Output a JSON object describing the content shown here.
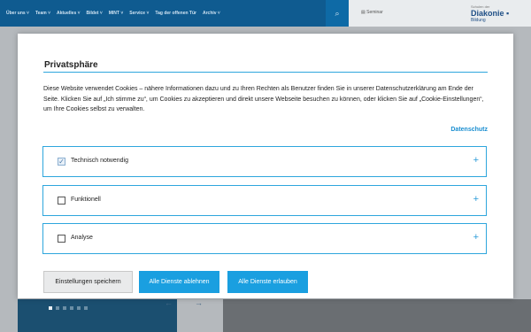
{
  "nav": {
    "items": [
      "Über uns",
      "Team",
      "Aktuelles",
      "Bildet",
      "MINT",
      "Service",
      "Tag der offenen Tür",
      "Archiv"
    ],
    "seminar_label": "Seminar"
  },
  "logo": {
    "top": "Schulen der",
    "main": "Diakonie",
    "sub": "Bildung"
  },
  "modal": {
    "title": "Privatsphäre",
    "description": "Diese Website verwendet Cookies – nähere Informationen dazu und zu Ihren Rechten als Benutzer finden Sie in unserer Datenschutzerklärung am Ende der Seite. Klicken Sie auf „Ich stimme zu“, um Cookies zu akzeptieren und direkt unsere Webseite besuchen zu können, oder klicken Sie auf „Cookie-Einstellungen“, um Ihre Cookies selbst zu verwalten.",
    "privacy_link": "Datenschutz",
    "categories": [
      {
        "label": "Technisch notwendig",
        "checked": true
      },
      {
        "label": "Funktionell",
        "checked": false
      },
      {
        "label": "Analyse",
        "checked": false
      }
    ],
    "buttons": {
      "save": "Einstellungen speichern",
      "deny": "Alle Dienste ablehnen",
      "allow": "Alle Dienste erlauben"
    }
  },
  "colors": {
    "accent": "#1a9fe0",
    "nav_bg": "#0f5b90"
  }
}
